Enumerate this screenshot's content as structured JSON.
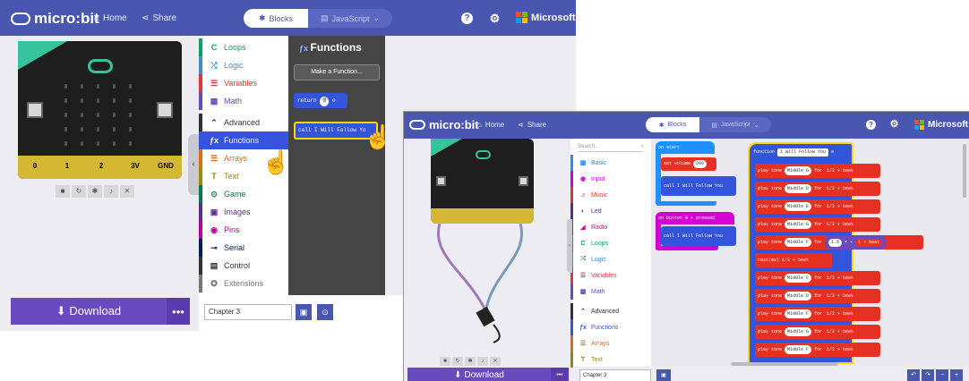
{
  "shot1": {
    "brand": "micro:bit",
    "home": "Home",
    "share": "Share",
    "blocks": "Blocks",
    "javascript": "JavaScript",
    "microsoft": "Microsoft",
    "pins": [
      "0",
      "1",
      "2",
      "3V",
      "GND"
    ],
    "download": "Download",
    "more": "•••",
    "project_name": "Chapter 3",
    "categories": [
      {
        "label": "Loops",
        "icon": "C",
        "color": "#00a65c"
      },
      {
        "label": "Logic",
        "icon": "⤮",
        "color": "#3e8bc8"
      },
      {
        "label": "Variables",
        "icon": "☰",
        "color": "#e5333f"
      },
      {
        "label": "Math",
        "icon": "▦",
        "color": "#6a4bbf"
      },
      {
        "label": "Advanced",
        "icon": "⌃",
        "color": "#333333"
      },
      {
        "label": "Functions",
        "icon": "ƒx",
        "color": "#3455db"
      },
      {
        "label": "Arrays",
        "icon": "☰",
        "color": "#e06a1a"
      },
      {
        "label": "Text",
        "icon": "T",
        "color": "#9a8a00"
      },
      {
        "label": "Game",
        "icon": "⊙",
        "color": "#007a4b"
      },
      {
        "label": "Images",
        "icon": "▣",
        "color": "#5c2d91"
      },
      {
        "label": "Pins",
        "icon": "◉",
        "color": "#b4009e"
      },
      {
        "label": "Serial",
        "icon": "⊸",
        "color": "#002050"
      },
      {
        "label": "Control",
        "icon": "▤",
        "color": "#333333"
      },
      {
        "label": "Extensions",
        "icon": "✪",
        "color": "#777777"
      }
    ],
    "flyout_title": "Functions",
    "make_function": "Make a Function...",
    "return_label": "return",
    "return_value": "0",
    "call_block": "call I Will Follow Yo"
  },
  "shot2": {
    "brand": "micro:bit",
    "home": "Home",
    "share": "Share",
    "blocks": "Blocks",
    "javascript": "JavaScript",
    "microsoft": "Microsoft",
    "search_placeholder": "Search...",
    "categories": [
      {
        "label": "Basic",
        "icon": "▦",
        "color": "#1e90ff"
      },
      {
        "label": "Input",
        "icon": "◉",
        "color": "#d400d4"
      },
      {
        "label": "Music",
        "icon": "♫",
        "color": "#e63022"
      },
      {
        "label": "Led",
        "icon": "◐",
        "color": "#5c2d91"
      },
      {
        "label": "Radio",
        "icon": "◢",
        "color": "#e3008c"
      },
      {
        "label": "Loops",
        "icon": "C",
        "color": "#00a65c"
      },
      {
        "label": "Logic",
        "icon": "⤮",
        "color": "#3e8bc8"
      },
      {
        "label": "Variables",
        "icon": "☰",
        "color": "#e5333f"
      },
      {
        "label": "Math",
        "icon": "▦",
        "color": "#6a4bbf"
      },
      {
        "label": "Advanced",
        "icon": "⌃",
        "color": "#333333"
      },
      {
        "label": "Functions",
        "icon": "ƒx",
        "color": "#3455db"
      },
      {
        "label": "Arrays",
        "icon": "☰",
        "color": "#e06a1a"
      },
      {
        "label": "Text",
        "icon": "T",
        "color": "#9a8a00"
      }
    ],
    "on_start": "on start",
    "set_volume": "set volume",
    "volume_value": "200",
    "call_follow": "call I Will Follow You",
    "on_button": "on button  B ▾  pressed",
    "call_follow2": "call I Will Follow You",
    "function_label": "function",
    "function_name": "I Will Follow You",
    "tone_rows": [
      {
        "note": "Middle G",
        "beat": "1/2 ▾ beat"
      },
      {
        "note": "Middle D",
        "beat": "1/2 ▾ beat"
      },
      {
        "note": "Middle E",
        "beat": "1/2 ▾ beat"
      },
      {
        "note": "Middle G",
        "beat": "1/2 ▾ beat"
      },
      {
        "note": "Middle F",
        "beat": "1 ▾ beat",
        "extra": "1.5"
      },
      {
        "rest": "rest(ms)  1/2 ▾ beat"
      },
      {
        "note": "Middle C",
        "beat": "1/2 ▾ beat"
      },
      {
        "note": "Middle D",
        "beat": "1/2 ▾ beat"
      },
      {
        "note": "Middle F",
        "beat": "1/2 ▾ beat"
      },
      {
        "note": "Middle G",
        "beat": "1/2 ▾ beat"
      },
      {
        "note": "Middle F",
        "beat": "1/2 ▾ beat"
      }
    ],
    "play_tone": "play tone",
    "for": "for",
    "times": "× ▾",
    "download": "Download",
    "more": "•••",
    "project_name": "Chapter 3"
  },
  "colors": {
    "topbar": "#4a57b0",
    "download": "#6a4bbf",
    "music_block": "#e63022",
    "functions_block": "#3455db",
    "basic_block": "#1e90ff",
    "math_block": "#6a4bbf"
  }
}
